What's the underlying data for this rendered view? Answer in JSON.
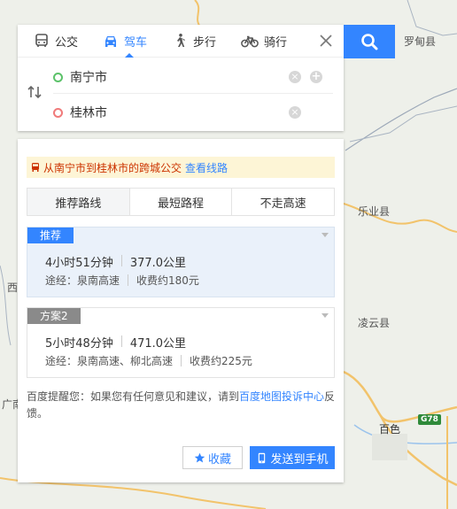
{
  "modes": [
    {
      "label": "公交",
      "icon": "bus-icon"
    },
    {
      "label": "驾车",
      "icon": "car-icon",
      "active": true
    },
    {
      "label": "步行",
      "icon": "walk-icon"
    },
    {
      "label": "骑行",
      "icon": "bike-icon"
    }
  ],
  "start": {
    "value": "南宁市"
  },
  "end": {
    "value": "桂林市"
  },
  "bus_tip": {
    "text": "从南宁市到桂林市的跨城公交",
    "link": "查看线路"
  },
  "pref_tabs": [
    "推荐路线",
    "最短路程",
    "不走高速"
  ],
  "plans": [
    {
      "badge": "推荐",
      "time": "4小时51分钟",
      "distance": "377.0公里",
      "via": "途经：泉南高速",
      "toll": "收费约180元"
    },
    {
      "badge": "方案2",
      "time": "5小时48分钟",
      "distance": "471.0公里",
      "via": "途经：泉南高速、柳北高速",
      "toll": "收费约225元"
    }
  ],
  "feedback": {
    "prefix": "百度提醒您：如果您有任何意见和建议，请到",
    "link": "百度地图投诉中心",
    "suffix": "反馈。"
  },
  "buttons": {
    "favorite": "收藏",
    "send": "发送到手机"
  },
  "map_labels": {
    "luodian": "罗甸县",
    "leye": "乐业县",
    "lingyun": "凌云县",
    "baise": "百色",
    "xi": "西",
    "guang": "广南",
    "highway": "G78"
  },
  "colors": {
    "accent": "#3385ff",
    "tip_text": "#cc3300",
    "tip_bg": "#fdf5d6"
  }
}
